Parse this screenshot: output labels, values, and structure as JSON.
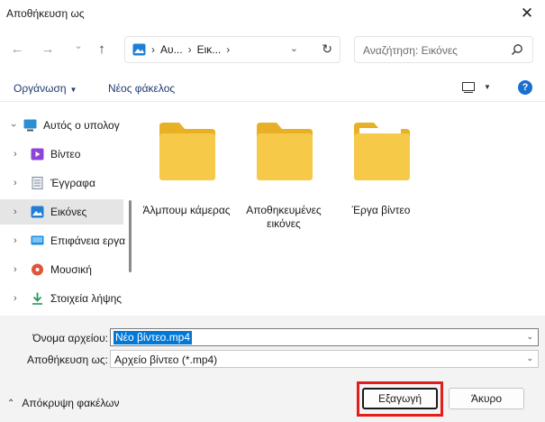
{
  "window": {
    "title": "Αποθήκευση ως"
  },
  "navigation": {
    "back_glyph": "←",
    "forward_glyph": "→",
    "recent_glyph": "⌄",
    "up_glyph": "↑",
    "breadcrumb": [
      "Αυ...",
      "Εικ..."
    ],
    "search_placeholder": "Αναζήτηση: Εικόνες"
  },
  "toolbar": {
    "organize_label": "Οργάνωση",
    "new_folder_label": "Νέος φάκελος"
  },
  "sidebar": {
    "items": [
      {
        "label": "Αυτός ο υπολογ",
        "icon": "pc-icon",
        "color": "#2b8fd6",
        "selected": false
      },
      {
        "label": "Βίντεο",
        "icon": "videos-icon",
        "color": "#8e44d6",
        "selected": false
      },
      {
        "label": "Έγγραφα",
        "icon": "documents-icon",
        "color": "#7d8a99",
        "selected": false
      },
      {
        "label": "Εικόνες",
        "icon": "pictures-icon",
        "color": "#1f7fd6",
        "selected": true
      },
      {
        "label": "Επιφάνεια εργα",
        "icon": "desktop-icon",
        "color": "#1f8fe0",
        "selected": false
      },
      {
        "label": "Μουσική",
        "icon": "music-icon",
        "color": "#e0553a",
        "selected": false
      },
      {
        "label": "Στοιχεία λήψης",
        "icon": "downloads-icon",
        "color": "#1e9b5a",
        "selected": false
      }
    ]
  },
  "folders": [
    {
      "label": "Άλμπουμ κάμερας",
      "icon": "folder-icon"
    },
    {
      "label": "Αποθηκευμένες εικόνες",
      "icon": "folder-icon"
    },
    {
      "label": "Έργα βίντεο",
      "icon": "folder-icon"
    }
  ],
  "form": {
    "filename_label": "Όνομα αρχείου:",
    "filename_value": "Νέο βίντεο.mp4",
    "savetype_label": "Αποθήκευση ως:",
    "savetype_value": "Αρχείο βίντεο (*.mp4)"
  },
  "footer": {
    "hide_folders_label": "Απόκρυψη φακέλων",
    "export_label": "Εξαγωγή",
    "cancel_label": "Άκυρο"
  },
  "colors": {
    "accent": "#0078d7",
    "folder": "#f7c948",
    "highlight": "#e31c1c"
  }
}
